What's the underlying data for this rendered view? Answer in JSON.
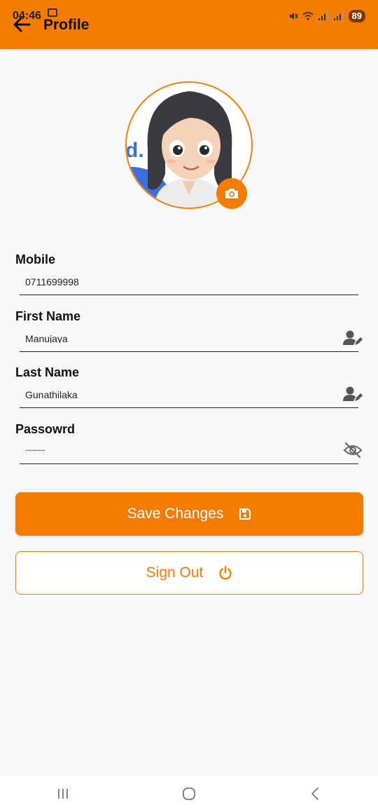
{
  "status_bar": {
    "time": "04:46",
    "battery": "89"
  },
  "app_bar": {
    "title": "Profile"
  },
  "profile": {
    "avatar_icon": "avatar-cartoon-girl",
    "camera_icon": "camera-icon"
  },
  "fields": {
    "mobile": {
      "label": "Mobile",
      "value": "0711699998"
    },
    "first_name": {
      "label": "First Name",
      "value": "Manujaya"
    },
    "last_name": {
      "label": "Last Name",
      "value": "Gunathilaka"
    },
    "password": {
      "label": "Passowrd",
      "value": "............"
    }
  },
  "buttons": {
    "save": "Save Changes",
    "sign_out": "Sign Out"
  },
  "colors": {
    "accent": "#f57c00",
    "background": "#f8f8f8",
    "text": "#111111"
  }
}
